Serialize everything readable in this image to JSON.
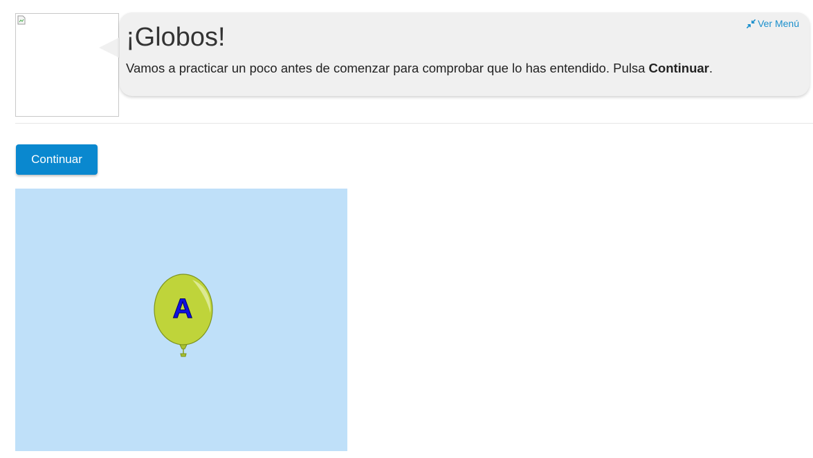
{
  "header": {
    "title": "¡Globos!",
    "instruction_prefix": "Vamos a practicar un poco antes de comenzar para comprobar que lo has entendido. Pulsa ",
    "instruction_bold": "Continuar",
    "instruction_suffix": ".",
    "menu_link_label": "Ver Menú",
    "menu_icon": "compress-arrows-icon",
    "avatar_icon": "broken-image-icon"
  },
  "actions": {
    "continue_label": "Continuar"
  },
  "game": {
    "balloon_letter": "A",
    "balloon_icon": "balloon-icon"
  },
  "colors": {
    "accent": "#0a88cf",
    "link": "#1a8fcc",
    "game_background": "#bfe0f9",
    "balloon_fill": "#bfd43a",
    "balloon_letter": "#1010e0"
  }
}
